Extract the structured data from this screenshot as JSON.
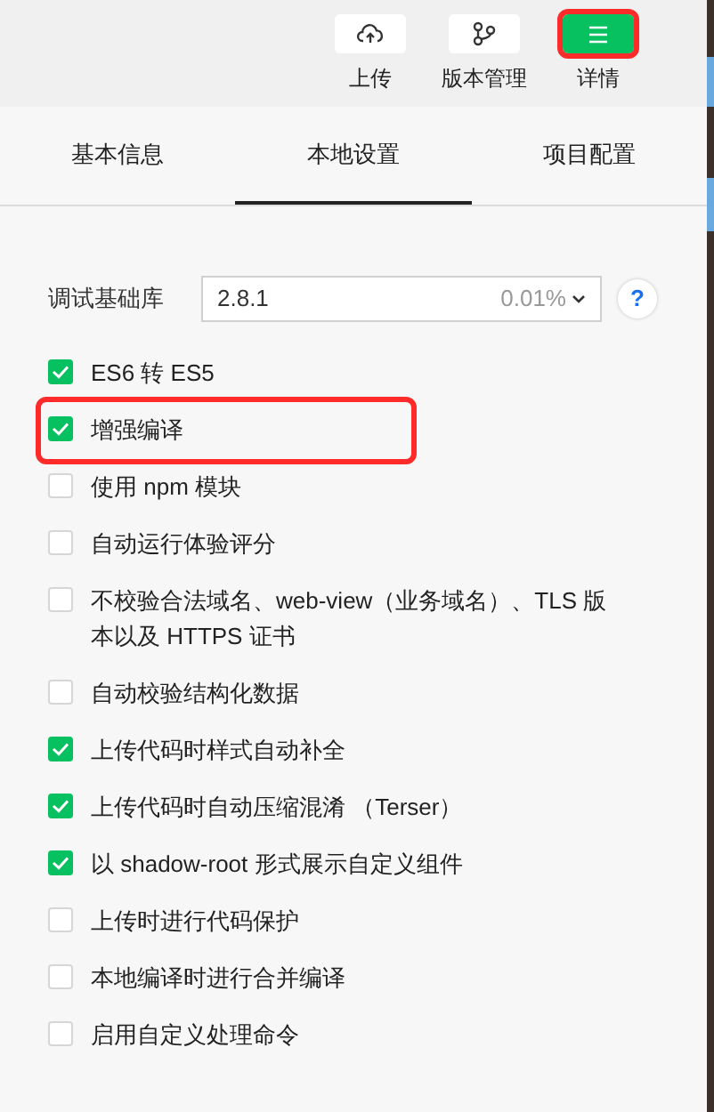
{
  "toolbar": [
    {
      "label": "上传",
      "kind": "upload",
      "selected": false,
      "highlighted": false
    },
    {
      "label": "版本管理",
      "kind": "versions",
      "selected": false,
      "highlighted": false
    },
    {
      "label": "详情",
      "kind": "details",
      "selected": true,
      "highlighted": true
    }
  ],
  "tabs": [
    {
      "label": "基本信息",
      "selected": false
    },
    {
      "label": "本地设置",
      "selected": true
    },
    {
      "label": "项目配置",
      "selected": false
    }
  ],
  "debug_library": {
    "label": "调试基础库",
    "value": "2.8.1",
    "usage": "0.01%",
    "help": "?"
  },
  "options": [
    {
      "label": "ES6 转 ES5",
      "checked": true,
      "highlighted": false
    },
    {
      "label": "增强编译",
      "checked": true,
      "highlighted": true
    },
    {
      "label": "使用 npm 模块",
      "checked": false,
      "highlighted": false
    },
    {
      "label": "自动运行体验评分",
      "checked": false,
      "highlighted": false
    },
    {
      "label": "不校验合法域名、web-view（业务域名）、TLS 版本以及 HTTPS 证书",
      "checked": false,
      "highlighted": false
    },
    {
      "label": "自动校验结构化数据",
      "checked": false,
      "highlighted": false
    },
    {
      "label": "上传代码时样式自动补全",
      "checked": true,
      "highlighted": false
    },
    {
      "label": "上传代码时自动压缩混淆 （Terser）",
      "checked": true,
      "highlighted": false
    },
    {
      "label": "以 shadow-root 形式展示自定义组件",
      "checked": true,
      "highlighted": false
    },
    {
      "label": "上传时进行代码保护",
      "checked": false,
      "highlighted": false
    },
    {
      "label": "本地编译时进行合并编译",
      "checked": false,
      "highlighted": false
    },
    {
      "label": "启用自定义处理命令",
      "checked": false,
      "highlighted": false
    }
  ]
}
